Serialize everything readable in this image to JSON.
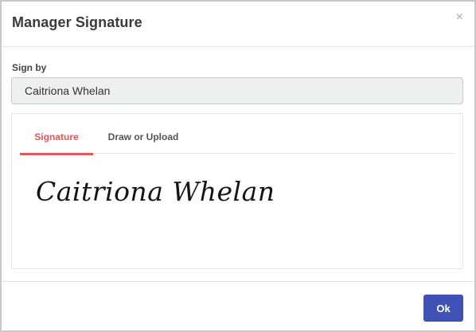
{
  "dialog": {
    "title": "Manager Signature",
    "close_glyph": "×"
  },
  "sign_by": {
    "label": "Sign by",
    "value": "Caitriona Whelan"
  },
  "tabs": [
    {
      "label": "Signature",
      "active": true
    },
    {
      "label": "Draw or Upload",
      "active": false
    }
  ],
  "signature": {
    "text": "Caitriona Whelan"
  },
  "footer": {
    "ok_label": "Ok"
  },
  "colors": {
    "accent_tab": "#e0585b",
    "primary_button": "#3f51b5",
    "input_background": "#edf0f1"
  }
}
